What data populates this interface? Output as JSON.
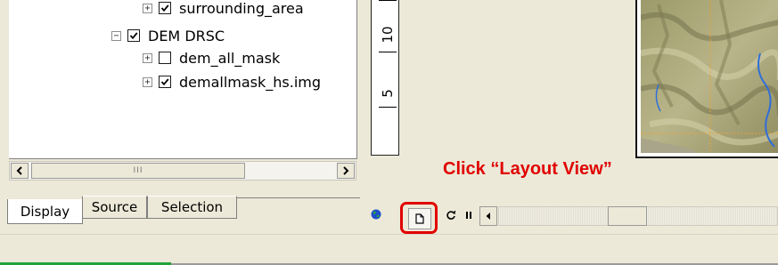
{
  "toc": {
    "layers": [
      {
        "label": "surrounding_area",
        "checked": true,
        "expander": "+",
        "indent": 1
      },
      {
        "label": "DEM DRSC",
        "checked": true,
        "expander": "−",
        "indent": 0
      },
      {
        "label": "dem_all_mask",
        "checked": false,
        "expander": "+",
        "indent": 1
      },
      {
        "label": "demallmask_hs.img",
        "checked": true,
        "expander": "+",
        "indent": 1
      }
    ],
    "scrollbar": {
      "grip": "III"
    },
    "tabs": [
      {
        "label": "Display",
        "active": true
      },
      {
        "label": "Source",
        "active": false
      },
      {
        "label": "Selection",
        "active": false
      }
    ]
  },
  "ruler": {
    "labels": [
      "10",
      "5"
    ]
  },
  "annotation": {
    "text": "Click “Layout View”",
    "color": "#e00000"
  },
  "view_toolbar": {
    "icons": [
      "globe-icon",
      "page-icon",
      "refresh-icon",
      "pause-icon",
      "left-arrow-icon"
    ]
  },
  "status_bar": {
    "progress_color": "#1fa33a"
  }
}
